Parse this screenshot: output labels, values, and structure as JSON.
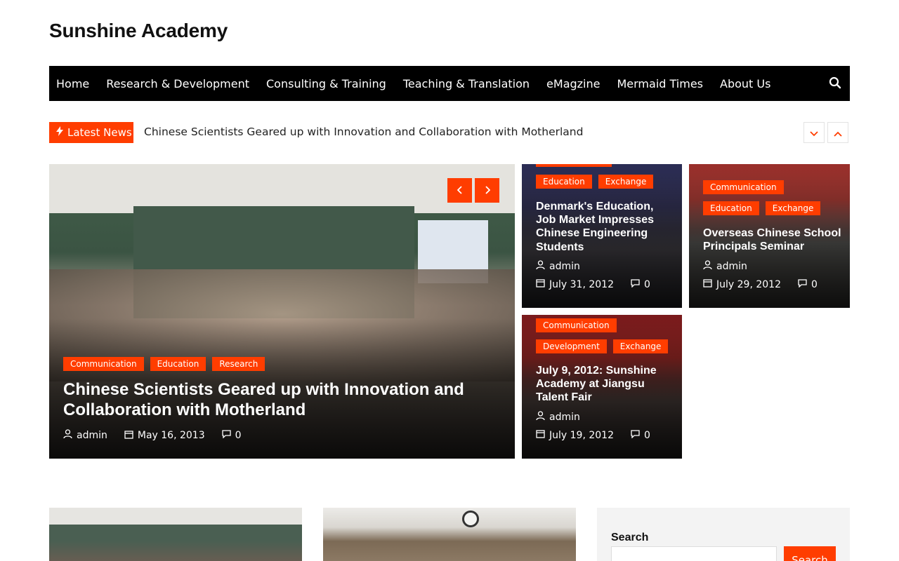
{
  "site": {
    "title": "Sunshine Academy"
  },
  "nav": {
    "items": [
      "Home",
      "Research & Development",
      "Consulting & Training",
      "Teaching & Translation",
      "eMagzine",
      "Mermaid Times",
      "About Us"
    ]
  },
  "ticker": {
    "label": "Latest News",
    "headline": "Chinese Scientists Geared up with Innovation and Collaboration with Motherland"
  },
  "main_post": {
    "categories": [
      "Communication",
      "Education",
      "Research"
    ],
    "title": "Chinese Scientists Geared up with Innovation and Collaboration with Motherland",
    "author": "admin",
    "date": "May 16, 2013",
    "comments": "0"
  },
  "post_b": {
    "categories": [
      "Education",
      "Exchange"
    ],
    "title": "Denmark's Education, Job Market Impresses Chinese Engineering Students",
    "author": "admin",
    "date": "July 31, 2012",
    "comments": "0"
  },
  "post_c": {
    "categories": [
      "Communication",
      "Education",
      "Exchange"
    ],
    "title": "Overseas Chinese School Principals Seminar",
    "author": "admin",
    "date": "July 29, 2012",
    "comments": "0"
  },
  "post_d": {
    "categories": [
      "Communication",
      "Development",
      "Exchange"
    ],
    "title": "July 9, 2012: Sunshine Academy at Jiangsu Talent Fair",
    "author": "admin",
    "date": "July 19, 2012",
    "comments": "0"
  },
  "sidebar": {
    "search_label": "Search",
    "search_button": "Search"
  },
  "colors": {
    "accent": "#ff3d00",
    "nav_bg": "#000000"
  }
}
